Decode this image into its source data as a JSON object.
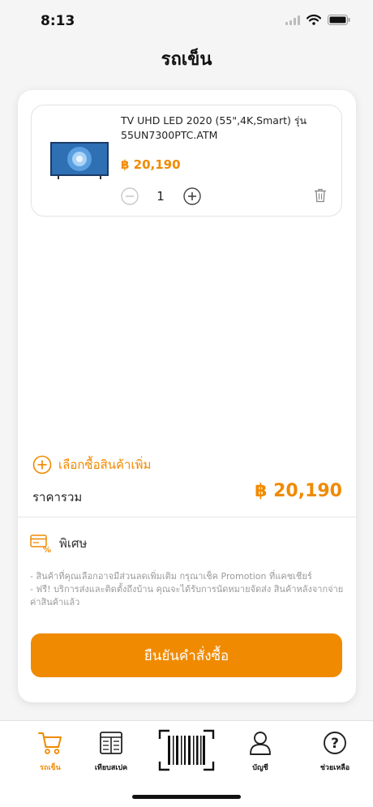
{
  "status_bar": {
    "time": "8:13"
  },
  "header": {
    "title": "รถเข็น"
  },
  "cart": {
    "items": [
      {
        "name": "TV UHD LED 2020 (55\",4K,Smart) รุ่น 55UN7300PTC.ATM",
        "price": "฿  20,190",
        "quantity": "1"
      }
    ],
    "add_more_label": "เลือกซื้อสินค้าเพิ่ม",
    "total_label": "ราคารวม",
    "total_value": "฿  20,190",
    "special": {
      "title": "พิเศษ",
      "notes": [
        "- สินค้าที่คุณเลือกอาจมีส่วนลดเพิ่มเติม กรุณาเช็ค Promotion ที่แคชเชียร์",
        "- ฟรี! บริการส่งและติดตั้งถึงบ้าน คุณจะได้รับการนัดหมายจัดส่ง สินค้าหลังจากจ่ายค่าสินค้าแล้ว"
      ]
    },
    "confirm_label": "ยืนยันคำสั่งซื้อ"
  },
  "tabs": [
    {
      "label": "รถเข็น",
      "icon": "cart-icon",
      "active": true
    },
    {
      "label": "เทียบสเปค",
      "icon": "compare-icon",
      "active": false
    },
    {
      "label": "",
      "icon": "barcode-scan-icon",
      "active": false
    },
    {
      "label": "บัญชี",
      "icon": "user-icon",
      "active": false
    },
    {
      "label": "ช่วยเหลือ",
      "icon": "help-icon",
      "active": false
    }
  ],
  "colors": {
    "accent": "#f08a00",
    "background": "#f5f5f5",
    "card": "#ffffff"
  }
}
